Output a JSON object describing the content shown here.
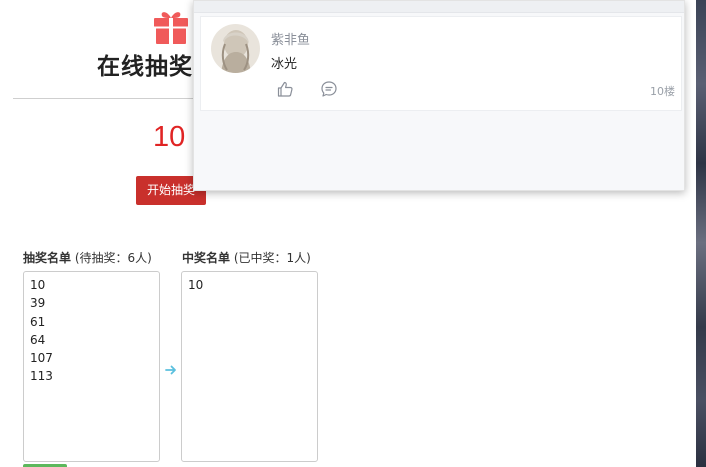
{
  "page": {
    "title": "在线抽奖",
    "current_number": "10",
    "start_button": "开始抽奖"
  },
  "pool": {
    "label_bold": "抽奖名单",
    "label_extra": " (待抽奖：6人)",
    "numbers": [
      "10",
      "39",
      "61",
      "64",
      "107",
      "113"
    ]
  },
  "winners": {
    "label_bold": "中奖名单",
    "label_extra": " (已中奖：1人)",
    "numbers": [
      "10"
    ]
  },
  "comment": {
    "username": "紫非鱼",
    "text": "冰光",
    "floor": "10楼"
  },
  "icons": {
    "gift": "gift-icon",
    "arrow": "arrow-right-icon",
    "like": "thumbs-up-icon",
    "reply": "comment-icon"
  },
  "colors": {
    "accent_red": "#e02424",
    "button_red": "#c9302c",
    "gift_red": "#f05a5a",
    "arrow_blue": "#5bc0de"
  }
}
